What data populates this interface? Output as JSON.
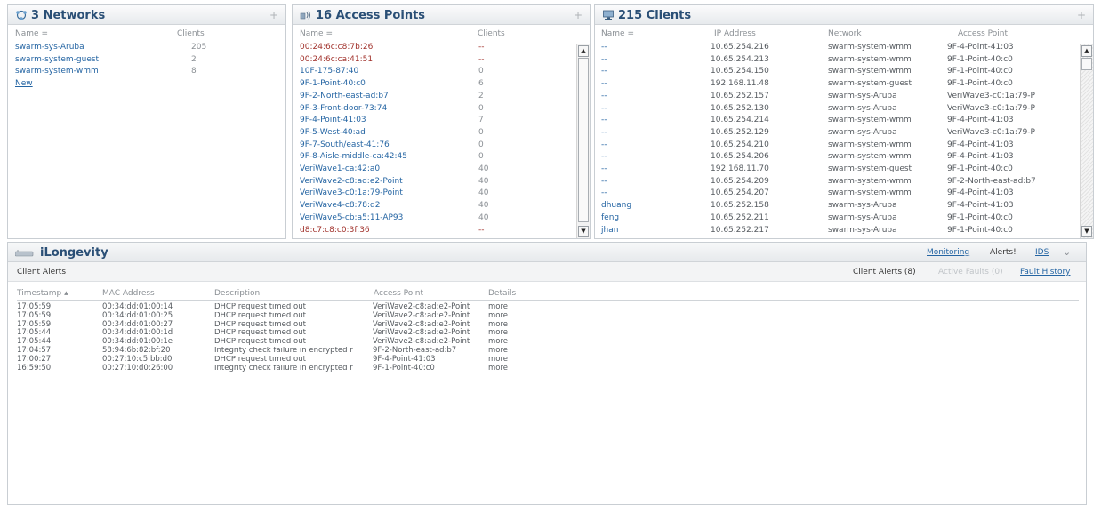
{
  "networks": {
    "title": "3 Networks",
    "plus": "+",
    "columns": {
      "name": "Name",
      "clients": "Clients"
    },
    "rows": [
      {
        "name": "swarm-sys-Aruba",
        "clients": "205"
      },
      {
        "name": "swarm-system-guest",
        "clients": "2"
      },
      {
        "name": "swarm-system-wmm",
        "clients": "8"
      }
    ],
    "new_link": "New"
  },
  "access_points": {
    "title": "16 Access Points",
    "plus": "+",
    "columns": {
      "name": "Name",
      "clients": "Clients"
    },
    "rows": [
      {
        "name": "00:24:6c:c8:7b:26",
        "clients": "--",
        "status": "down"
      },
      {
        "name": "00:24:6c:ca:41:51",
        "clients": "--",
        "status": "down"
      },
      {
        "name": "10F-175-87:40",
        "clients": "0",
        "status": "up"
      },
      {
        "name": "9F-1-Point-40:c0",
        "clients": "6",
        "status": "up"
      },
      {
        "name": "9F-2-North-east-ad:b7",
        "clients": "2",
        "status": "up"
      },
      {
        "name": "9F-3-Front-door-73:74",
        "clients": "0",
        "status": "up"
      },
      {
        "name": "9F-4-Point-41:03",
        "clients": "7",
        "status": "up"
      },
      {
        "name": "9F-5-West-40:ad",
        "clients": "0",
        "status": "up"
      },
      {
        "name": "9F-7-South/east-41:76",
        "clients": "0",
        "status": "up"
      },
      {
        "name": "9F-8-Aisle-middle-ca:42:45",
        "clients": "0",
        "status": "up"
      },
      {
        "name": "VeriWave1-ca:42:a0",
        "clients": "40",
        "status": "up"
      },
      {
        "name": "VeriWave2-c8:ad:e2-Point",
        "clients": "40",
        "status": "up"
      },
      {
        "name": "VeriWave3-c0:1a:79-Point",
        "clients": "40",
        "status": "up"
      },
      {
        "name": "VeriWave4-c8:78:d2",
        "clients": "40",
        "status": "up"
      },
      {
        "name": "VeriWave5-cb:a5:11-AP93",
        "clients": "40",
        "status": "up"
      },
      {
        "name": "d8:c7:c8:c0:3f:36",
        "clients": "--",
        "status": "down"
      }
    ]
  },
  "clients": {
    "title": "215 Clients",
    "plus": "+",
    "columns": {
      "name": "Name",
      "ip": "IP Address",
      "network": "Network",
      "ap": "Access Point"
    },
    "rows": [
      {
        "name": "--",
        "ip": "10.65.254.216",
        "network": "swarm-system-wmm",
        "ap": "9F-4-Point-41:03"
      },
      {
        "name": "--",
        "ip": "10.65.254.213",
        "network": "swarm-system-wmm",
        "ap": "9F-1-Point-40:c0"
      },
      {
        "name": "--",
        "ip": "10.65.254.150",
        "network": "swarm-system-wmm",
        "ap": "9F-1-Point-40:c0"
      },
      {
        "name": "--",
        "ip": "192.168.11.48",
        "network": "swarm-system-guest",
        "ap": "9F-1-Point-40:c0"
      },
      {
        "name": "--",
        "ip": "10.65.252.157",
        "network": "swarm-sys-Aruba",
        "ap": "VeriWave3-c0:1a:79-P"
      },
      {
        "name": "--",
        "ip": "10.65.252.130",
        "network": "swarm-sys-Aruba",
        "ap": "VeriWave3-c0:1a:79-P"
      },
      {
        "name": "--",
        "ip": "10.65.254.214",
        "network": "swarm-system-wmm",
        "ap": "9F-4-Point-41:03"
      },
      {
        "name": "--",
        "ip": "10.65.252.129",
        "network": "swarm-sys-Aruba",
        "ap": "VeriWave3-c0:1a:79-P"
      },
      {
        "name": "--",
        "ip": "10.65.254.210",
        "network": "swarm-system-wmm",
        "ap": "9F-4-Point-41:03"
      },
      {
        "name": "--",
        "ip": "10.65.254.206",
        "network": "swarm-system-wmm",
        "ap": "9F-4-Point-41:03"
      },
      {
        "name": "--",
        "ip": "192.168.11.70",
        "network": "swarm-system-guest",
        "ap": "9F-1-Point-40:c0"
      },
      {
        "name": "--",
        "ip": "10.65.254.209",
        "network": "swarm-system-wmm",
        "ap": "9F-2-North-east-ad:b7"
      },
      {
        "name": "--",
        "ip": "10.65.254.207",
        "network": "swarm-system-wmm",
        "ap": "9F-4-Point-41:03"
      },
      {
        "name": "dhuang",
        "ip": "10.65.252.158",
        "network": "swarm-sys-Aruba",
        "ap": "9F-4-Point-41:03"
      },
      {
        "name": "feng",
        "ip": "10.65.252.211",
        "network": "swarm-sys-Aruba",
        "ap": "9F-1-Point-40:c0"
      },
      {
        "name": "jhan",
        "ip": "10.65.252.217",
        "network": "swarm-sys-Aruba",
        "ap": "9F-1-Point-40:c0"
      }
    ]
  },
  "bottom": {
    "title": "iLongevity",
    "nav": {
      "monitoring": "Monitoring",
      "alerts": "Alerts!",
      "ids": "IDS"
    },
    "subhead": {
      "label": "Client Alerts",
      "client_alerts": "Client Alerts (8)",
      "active_faults": "Active Faults (0)",
      "fault_history": "Fault History"
    },
    "columns": {
      "timestamp": "Timestamp",
      "mac": "MAC Address",
      "description": "Description",
      "ap": "Access Point",
      "details": "Details"
    },
    "rows": [
      {
        "timestamp": "17:05:59",
        "mac": "00:34:dd:01:00:14",
        "description": "DHCP request timed out",
        "ap": "VeriWave2-c8:ad:e2-Point",
        "details": "more"
      },
      {
        "timestamp": "17:05:59",
        "mac": "00:34:dd:01:00:25",
        "description": "DHCP request timed out",
        "ap": "VeriWave2-c8:ad:e2-Point",
        "details": "more"
      },
      {
        "timestamp": "17:05:59",
        "mac": "00:34:dd:01:00:27",
        "description": "DHCP request timed out",
        "ap": "VeriWave2-c8:ad:e2-Point",
        "details": "more"
      },
      {
        "timestamp": "17:05:44",
        "mac": "00:34:dd:01:00:1d",
        "description": "DHCP request timed out",
        "ap": "VeriWave2-c8:ad:e2-Point",
        "details": "more"
      },
      {
        "timestamp": "17:05:44",
        "mac": "00:34:dd:01:00:1e",
        "description": "DHCP request timed out",
        "ap": "VeriWave2-c8:ad:e2-Point",
        "details": "more"
      },
      {
        "timestamp": "17:04:57",
        "mac": "58:94:6b:82:bf:20",
        "description": "Integrity check failure in encrypted r",
        "ap": "9F-2-North-east-ad:b7",
        "details": "more"
      },
      {
        "timestamp": "17:00:27",
        "mac": "00:27:10:c5:bb:d0",
        "description": "DHCP request timed out",
        "ap": "9F-4-Point-41:03",
        "details": "more"
      },
      {
        "timestamp": "16:59:50",
        "mac": "00:27:10:d0:26:00",
        "description": "Integrity check failure in encrypted r",
        "ap": "9F-1-Point-40:c0",
        "details": "more"
      }
    ]
  },
  "colors": {
    "title": "#2a4f76",
    "link": "#2565a3",
    "down": "#a0302a",
    "muted": "#8a8f94"
  },
  "icons": {
    "networks": "networks-icon",
    "access_points": "wireless-ap-icon",
    "clients": "computer-icon",
    "longevity": "swarm-device-icon",
    "sort": "sort-arrow-icon",
    "scroll_up": "scroll-up-arrow-icon",
    "scroll_down": "scroll-down-arrow-icon",
    "collapse": "chevron-down-icon"
  }
}
